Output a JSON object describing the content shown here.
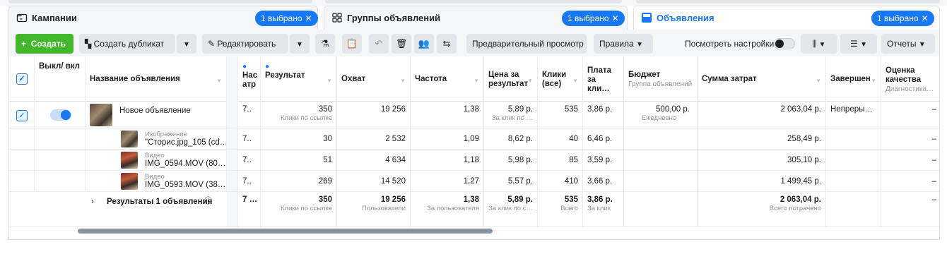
{
  "tabs": [
    {
      "label": "Кампании",
      "icon": "folder-icon"
    },
    {
      "label": "Группы объявлений",
      "icon": "grid-icon",
      "badge": "1 выбрано"
    },
    {
      "label": "Объявления",
      "icon": "ad-icon",
      "badge": "1 выбрано"
    }
  ],
  "campaign_badge": "1 выбрано",
  "toolbar": {
    "create": "Создать",
    "duplicate": "Создать дубликат",
    "edit": "Редактировать",
    "preview": "Предварительный просмотр",
    "rules": "Правила",
    "view_settings": "Посмотреть настройки",
    "reports": "Отчеты"
  },
  "columns": {
    "toggle": "Выкл/ вкл",
    "name": "Название объявления",
    "settings": "Нас атр",
    "result": "Результат",
    "reach": "Охват",
    "frequency": "Частота",
    "cost_per_result": "Цена за результат",
    "clicks": "Клики (все)",
    "cpc": "Плата за кли…",
    "budget": "Бюджет",
    "budget_sub": "Группа объявлений",
    "spent": "Сумма затрат",
    "end": "Завершен",
    "quality": "Оценка качества",
    "quality_sub": "Диагностика…"
  },
  "main_row": {
    "name": "Новое объявление",
    "settings": "7..",
    "result": "350",
    "result_sub": "Клики по ссылке",
    "reach": "19 256",
    "frequency": "1,38",
    "cost_per_result": "5,89 р.",
    "cost_sub": "За клик по …",
    "clicks": "535",
    "cpc": "3,86 р.",
    "budget": "500,00 р.",
    "budget_sub": "Ежедневно",
    "spent": "2 063,04 р.",
    "end": "Непреры…",
    "quality": "–"
  },
  "sub_rows": [
    {
      "type": "Изображение",
      "name": "\"Сторис.jpg_105 (cd…",
      "settings": "7..",
      "result": "30",
      "reach": "2 532",
      "frequency": "1,09",
      "cost": "8,62 р.",
      "clicks": "40",
      "cpc": "6,46 р.",
      "spent": "258,49 р.",
      "quality": "–"
    },
    {
      "type": "Видео",
      "name": "IMG_0594.MOV (80…",
      "settings": "7..",
      "result": "51",
      "reach": "4 634",
      "frequency": "1,18",
      "cost": "5,98 р.",
      "clicks": "85",
      "cpc": "3,59 р.",
      "spent": "305,10 р.",
      "quality": "–"
    },
    {
      "type": "Видео",
      "name": "IMG_0593.MOV (38…",
      "settings": "7..",
      "result": "269",
      "reach": "14 520",
      "frequency": "1,27",
      "cost": "5,57 р.",
      "clicks": "410",
      "cpc": "3,66 р.",
      "spent": "1 499,45 р.",
      "quality": "–"
    }
  ],
  "totals": {
    "label": "Результаты 1 объявления",
    "settings": "7 …",
    "result": "350",
    "result_sub": "Клики по ссылке",
    "reach": "19 256",
    "reach_sub": "Пользователи",
    "frequency": "1,38",
    "frequency_sub": "За пользователя",
    "cost": "5,89 р.",
    "cost_sub": "За клик по с…",
    "clicks": "535",
    "clicks_sub": "Всего",
    "cpc": "3,86 р.",
    "cpc_sub": "За клик",
    "spent": "2 063,04 р.",
    "spent_sub": "Всего потрачено",
    "quality": "–"
  },
  "colors": {
    "accent": "#1877f2",
    "create": "#42b72a"
  }
}
